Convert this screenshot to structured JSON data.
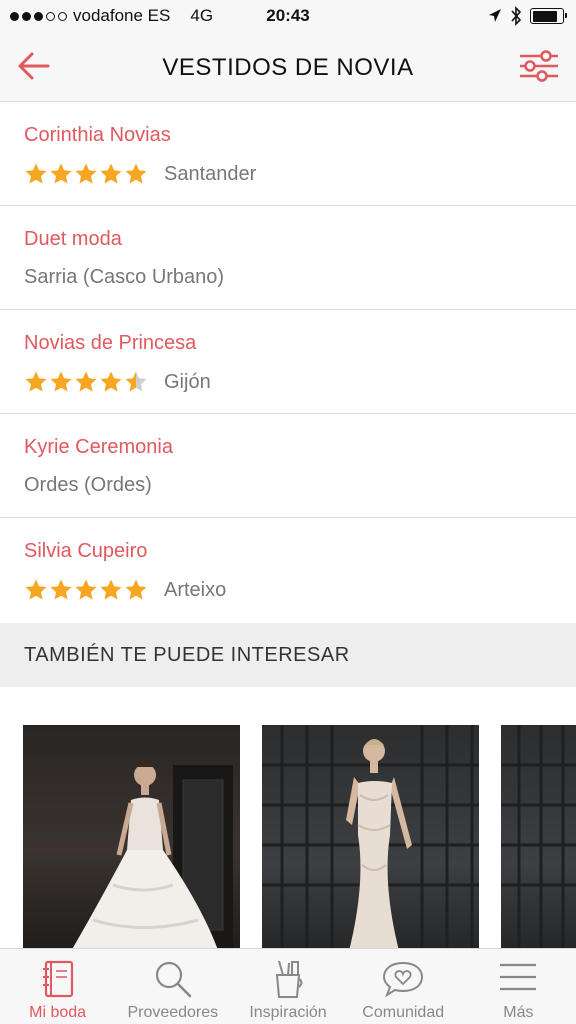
{
  "status": {
    "carrier": "vodafone ES",
    "network": "4G",
    "time": "20:43"
  },
  "nav": {
    "title": "VESTIDOS DE NOVIA",
    "back_icon": "arrow-left-icon",
    "filter_icon": "sliders-icon"
  },
  "accent_color": "#e0595e",
  "star_color": "#f5a623",
  "providers": [
    {
      "name": "Corinthia Novias",
      "rating": 5,
      "location": "Santander"
    },
    {
      "name": "Duet moda",
      "rating": null,
      "location": "Sarria (Casco Urbano)"
    },
    {
      "name": "Novias de Princesa",
      "rating": 4.5,
      "location": "Gijón"
    },
    {
      "name": "Kyrie Ceremonia",
      "rating": null,
      "location": "Ordes (Ordes)"
    },
    {
      "name": "Silvia Cupeiro",
      "rating": 5,
      "location": "Arteixo"
    }
  ],
  "section": {
    "title": "TAMBIÉN TE PUEDE INTERESAR"
  },
  "tabs": [
    {
      "label": "Mi boda",
      "icon": "notebook-icon",
      "active": true
    },
    {
      "label": "Proveedores",
      "icon": "search-icon",
      "active": false
    },
    {
      "label": "Inspiración",
      "icon": "pencil-cup-icon",
      "active": false
    },
    {
      "label": "Comunidad",
      "icon": "heart-bubble-icon",
      "active": false
    },
    {
      "label": "Más",
      "icon": "menu-icon",
      "active": false
    }
  ]
}
